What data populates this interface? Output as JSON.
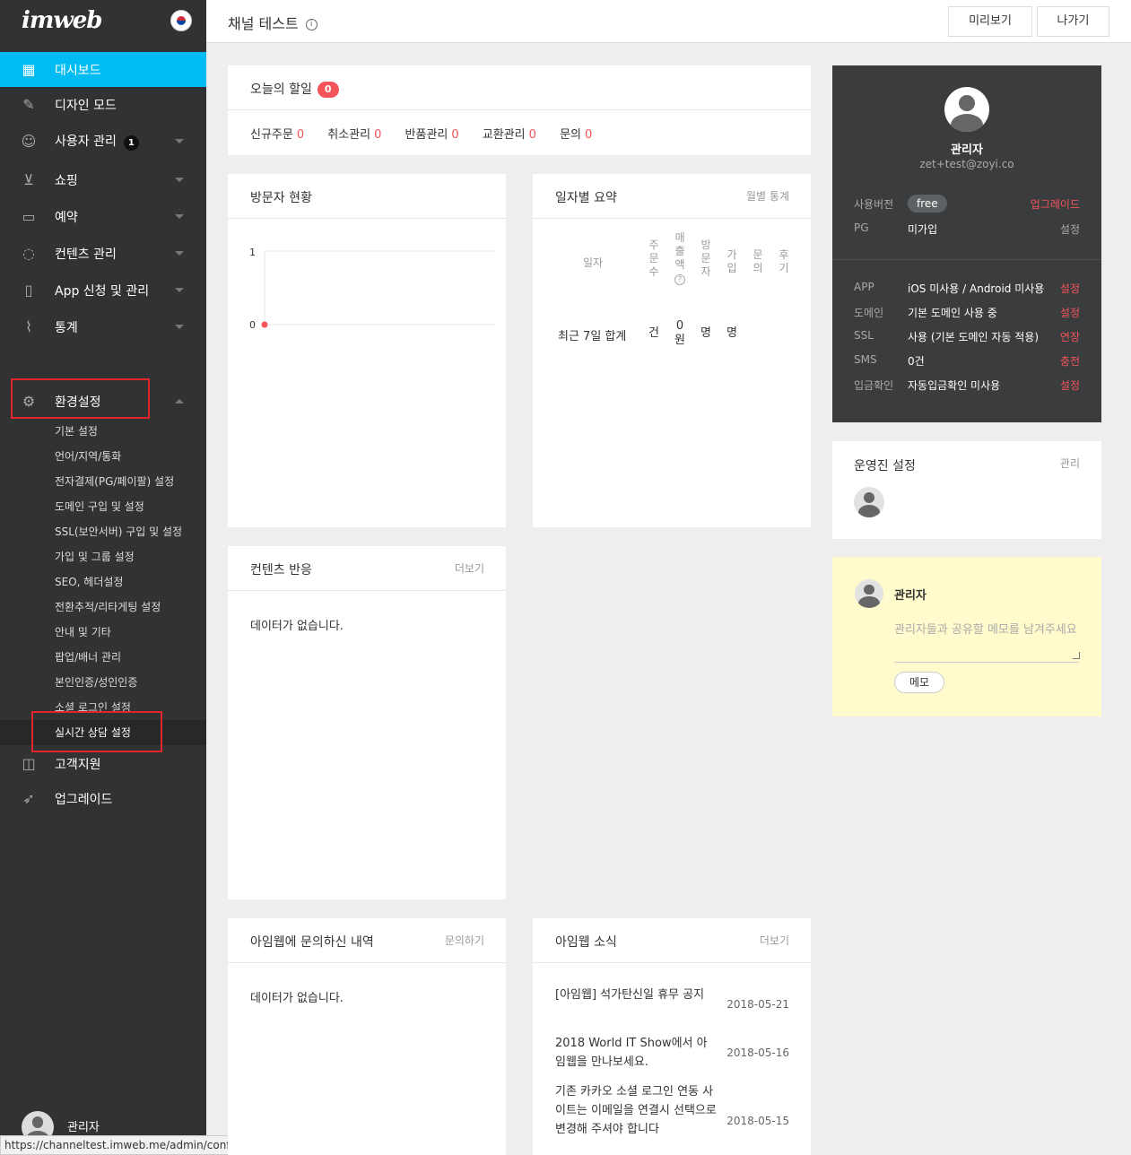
{
  "app": {
    "logo": "imweb"
  },
  "sidebar": {
    "items": [
      {
        "label": "대시보드",
        "icon": "dashboard-icon"
      },
      {
        "label": "디자인 모드",
        "icon": "design-icon"
      },
      {
        "label": "사용자 관리",
        "icon": "user-icon",
        "badge": "1"
      },
      {
        "label": "쇼핑",
        "icon": "cart-icon"
      },
      {
        "label": "예약",
        "icon": "calendar-icon"
      },
      {
        "label": "컨텐츠 관리",
        "icon": "chat-icon"
      },
      {
        "label": "App 신청 및 관리",
        "icon": "phone-icon"
      },
      {
        "label": "통계",
        "icon": "chart-icon"
      },
      {
        "label": "환경설정",
        "icon": "gear-icon"
      },
      {
        "label": "고객지원",
        "icon": "support-icon"
      },
      {
        "label": "업그레이드",
        "icon": "rocket-icon"
      }
    ],
    "settings_sub": [
      "기본 설정",
      "언어/지역/통화",
      "전자결제(PG/페이팔) 설정",
      "도메인 구입 및 설정",
      "SSL(보안서버) 구입 및 설정",
      "가입 및 그룹 설정",
      "SEO, 헤더설정",
      "전환추적/리타게팅 설정",
      "안내 및 기타",
      "팝업/배너 관리",
      "본인인증/성인인증",
      "소셜 로그인 설정",
      "실시간 상담 설정"
    ],
    "user_name": "관리자"
  },
  "statusbar": {
    "url": "https://channeltest.imweb.me/admin/config/chat"
  },
  "header": {
    "title": "채널 테스트",
    "info": "i",
    "preview": "미리보기",
    "exit": "나가기"
  },
  "todo": {
    "title": "오늘의 할일",
    "count": "0",
    "items": [
      {
        "label": "신규주문",
        "value": "0"
      },
      {
        "label": "취소관리",
        "value": "0"
      },
      {
        "label": "반품관리",
        "value": "0"
      },
      {
        "label": "교환관리",
        "value": "0"
      },
      {
        "label": "문의",
        "value": "0"
      }
    ]
  },
  "visitors": {
    "title": "방문자 현황"
  },
  "chart_data": {
    "type": "line",
    "title": "방문자 현황",
    "x": [
      0
    ],
    "series": [
      {
        "values": [
          0
        ]
      }
    ],
    "ylim": [
      0,
      1
    ],
    "yticks": [
      "1",
      "0"
    ],
    "grid": true,
    "color": "#f5545b"
  },
  "summary": {
    "title": "일자별 요약",
    "link": "월별 통계",
    "col_date": "일자",
    "col_orders": "주문수",
    "col_sales": "매출액",
    "col_visitors": "방문자",
    "col_signup": "가입",
    "col_inquiry": "문의",
    "col_review": "후기",
    "row_label": "최근 7일 합계",
    "v_orders": "건",
    "v_sales_num": "0",
    "v_sales_unit": "원",
    "v_visitors": "명",
    "v_signup": "명"
  },
  "contents": {
    "title": "컨텐츠 반응",
    "link": "더보기",
    "empty": "데이터가 없습니다."
  },
  "inquiry": {
    "title": "아임웹에 문의하신 내역",
    "link": "문의하기",
    "empty": "데이터가 없습니다."
  },
  "news": {
    "title": "아임웹 소식",
    "link": "더보기",
    "items": [
      {
        "title": "[아임웹] 석가탄신일 휴무 공지",
        "date": "2018-05-21"
      },
      {
        "title": "2018 World IT Show에서 아임웹을 만나보세요.",
        "date": "2018-05-16"
      },
      {
        "title": "기존 카카오 소셜 로그인 연동 사이트는 이메일을 연결시 선택으로 변경해 주셔야 합니다",
        "date": "2018-05-15"
      }
    ]
  },
  "admin": {
    "name": "관리자",
    "email": "zet+test@zoyi.co",
    "plan_key": "사용버전",
    "plan_val": "free",
    "plan_act": "업그레이드",
    "pg_key": "PG",
    "pg_val": "미가입",
    "pg_act": "설정",
    "rows": [
      {
        "key": "APP",
        "val": "iOS 미사용 / Android 미사용",
        "act": "설정"
      },
      {
        "key": "도메인",
        "val": "기본 도메인 사용 중",
        "act": "설정"
      },
      {
        "key": "SSL",
        "val": "사용 (기본 도메인 자동 적용)",
        "act": "연장"
      },
      {
        "key": "SMS",
        "val": "0건",
        "act": "충전"
      },
      {
        "key": "입금확인",
        "val": "자동입금확인 미사용",
        "act": "설정"
      }
    ]
  },
  "staff": {
    "title": "운영진 설정",
    "link": "관리"
  },
  "memo": {
    "name": "관리자",
    "placeholder": "관리자들과 공유할 메모를 남겨주세요",
    "button": "메모"
  },
  "colors": {
    "accent": "#00bcf2",
    "alert": "#f5545b",
    "sidebar": "#303233"
  }
}
